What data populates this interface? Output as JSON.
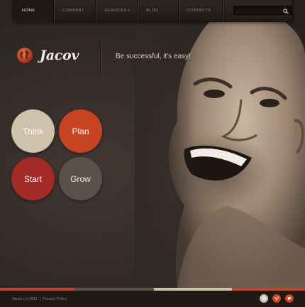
{
  "nav": {
    "items": [
      {
        "label": "HOME",
        "active": true
      },
      {
        "label": "COMPANY",
        "active": false
      },
      {
        "label": "SERVICES",
        "active": false
      },
      {
        "label": "BLOG",
        "active": false
      },
      {
        "label": "CONTACTS",
        "active": false
      }
    ],
    "search": {
      "placeholder": "",
      "value": ""
    }
  },
  "brand": {
    "name": "Jacov",
    "tagline": "Be successful, it's easy!"
  },
  "circles": {
    "think": "Think",
    "plan": "Plan",
    "start": "Start",
    "grow": "Grow"
  },
  "footer": {
    "copyright": "Jacov (c) 2011",
    "separator": "|",
    "privacy": "Privacy Policy"
  },
  "colors": {
    "accent_orange": "#c8431f",
    "accent_red": "#a32a26",
    "beige": "#cfc2ab",
    "dark_gray": "#5b514b",
    "background": "#2f2925"
  },
  "icons": {
    "logo": "globe-icon",
    "search": "search-icon",
    "social": [
      "dribbble-icon",
      "vimeo-icon",
      "twitter-icon"
    ]
  }
}
